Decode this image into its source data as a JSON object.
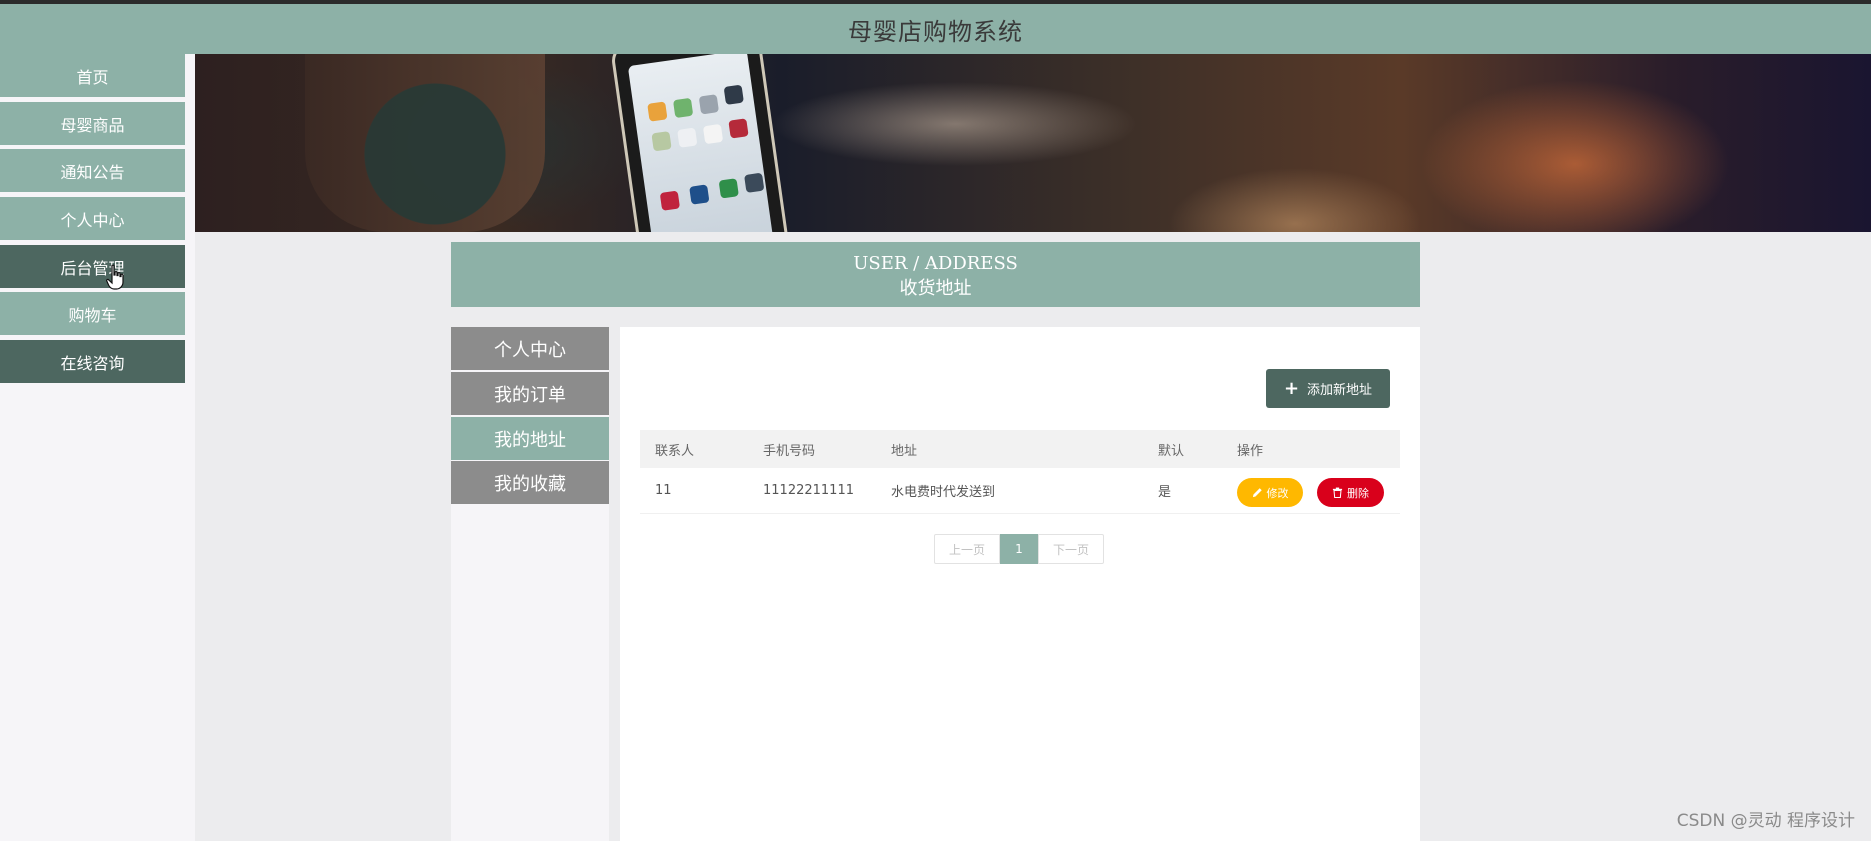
{
  "app": {
    "title": "母婴店购物系统"
  },
  "nav": {
    "items": [
      {
        "label": "首页"
      },
      {
        "label": "母婴商品"
      },
      {
        "label": "通知公告"
      },
      {
        "label": "个人中心"
      },
      {
        "label": "后台管理"
      },
      {
        "label": "购物车"
      },
      {
        "label": "在线咨询"
      }
    ]
  },
  "section": {
    "en": "USER / ADDRESS",
    "zh": "收货地址"
  },
  "user_menu": {
    "items": [
      {
        "label": "个人中心"
      },
      {
        "label": "我的订单"
      },
      {
        "label": "我的地址"
      },
      {
        "label": "我的收藏"
      }
    ],
    "active": "我的地址"
  },
  "toolbar": {
    "add_label": "添加新地址",
    "add_icon": "plus-icon"
  },
  "table": {
    "headers": [
      "联系人",
      "手机号码",
      "地址",
      "默认",
      "操作"
    ],
    "rows": [
      {
        "contact": "11",
        "phone": "11122211111",
        "address": "水电费时代发送到",
        "default": "是",
        "edit_label": "修改",
        "delete_label": "删除"
      }
    ]
  },
  "pager": {
    "prev": "上一页",
    "current": "1",
    "next": "下一页"
  },
  "watermark": "CSDN @灵动 程序设计",
  "colors": {
    "primary": "#8db1a7",
    "dark": "#4d6760",
    "edit": "#ffb800",
    "delete": "#d9001b",
    "menu_gray": "#8c8c8c"
  }
}
